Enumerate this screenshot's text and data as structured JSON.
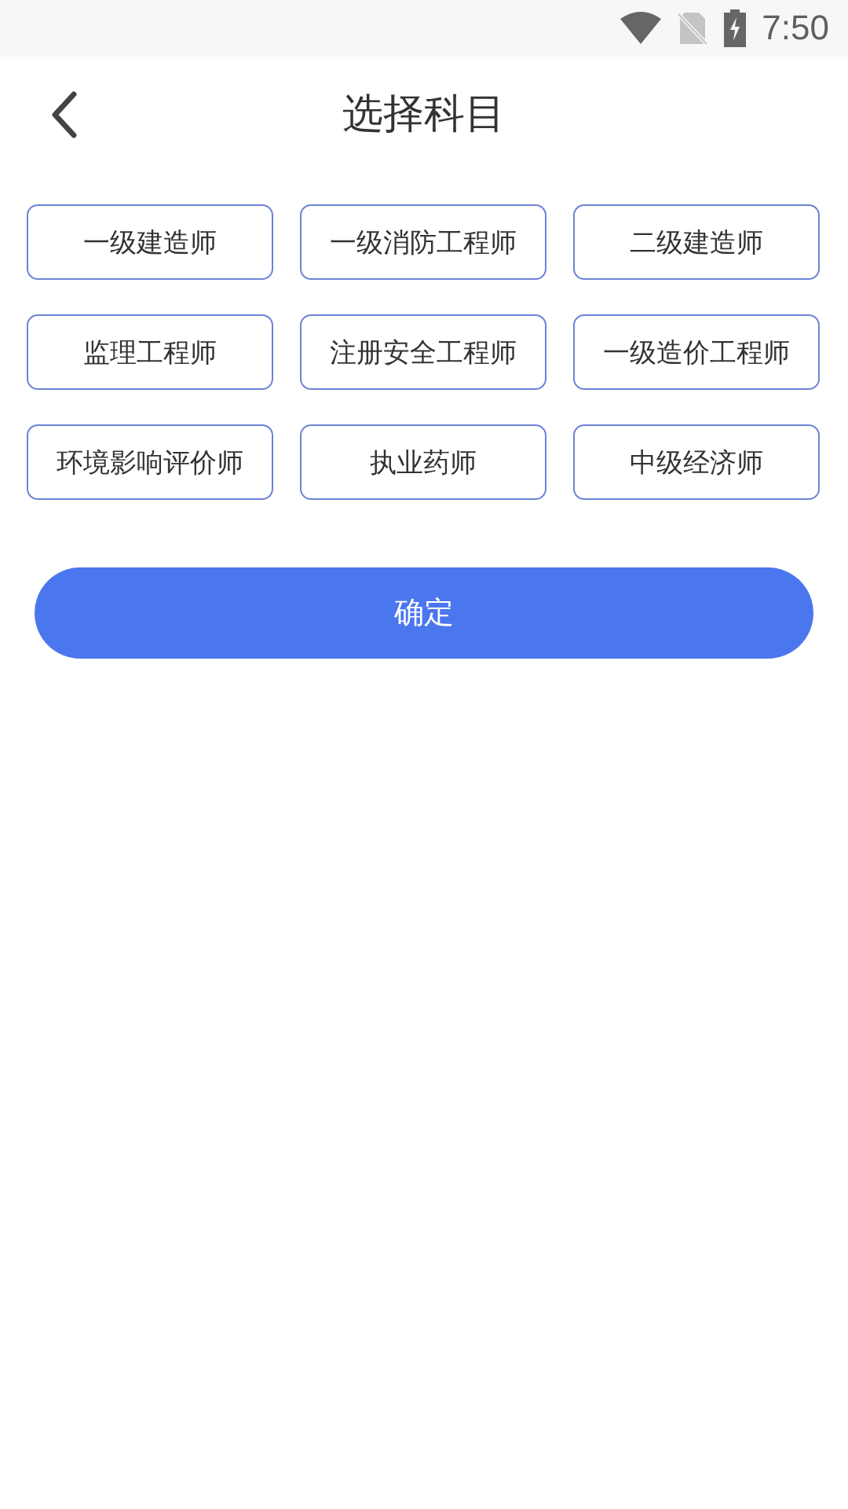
{
  "status_bar": {
    "time": "7:50"
  },
  "header": {
    "title": "选择科目"
  },
  "subjects": [
    {
      "label": "一级建造师",
      "selected": false
    },
    {
      "label": "一级消防工程师",
      "selected": false
    },
    {
      "label": "二级建造师",
      "selected": false
    },
    {
      "label": "监理工程师",
      "selected": false
    },
    {
      "label": "注册安全工程师",
      "selected": false
    },
    {
      "label": "一级造价工程师",
      "selected": false
    },
    {
      "label": "环境影响评价师",
      "selected": false
    },
    {
      "label": "执业药师",
      "selected": false
    },
    {
      "label": "中级经济师",
      "selected": false
    }
  ],
  "confirm_button": {
    "label": "确定"
  }
}
